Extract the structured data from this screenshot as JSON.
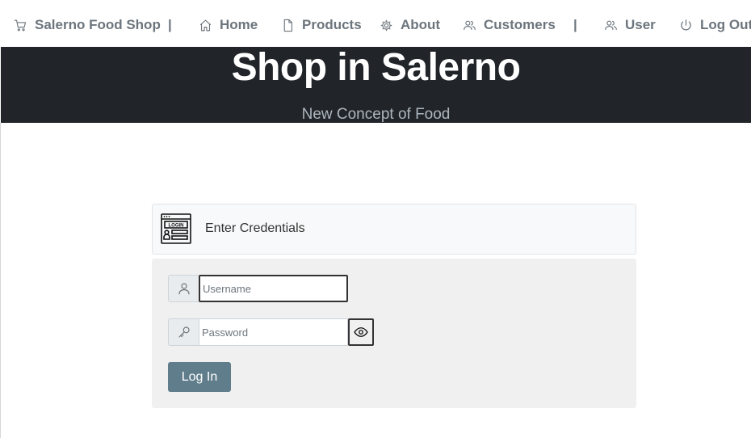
{
  "nav": {
    "brand": "Salerno Food Shop",
    "separator": "|",
    "items": {
      "home": "Home",
      "products": "Products",
      "about": "About",
      "customers": "Customers",
      "user": "User",
      "logout": "Log Out"
    }
  },
  "hero": {
    "title": "Shop in Salerno",
    "subtitle": "New Concept of Food"
  },
  "login": {
    "header_title": "Enter Credentials",
    "username_placeholder": "Username",
    "password_placeholder": "Password",
    "submit_label": "Log In"
  },
  "colors": {
    "nav_text": "#6c757d",
    "hero_bg": "#212529",
    "button_bg": "#607d8b"
  }
}
